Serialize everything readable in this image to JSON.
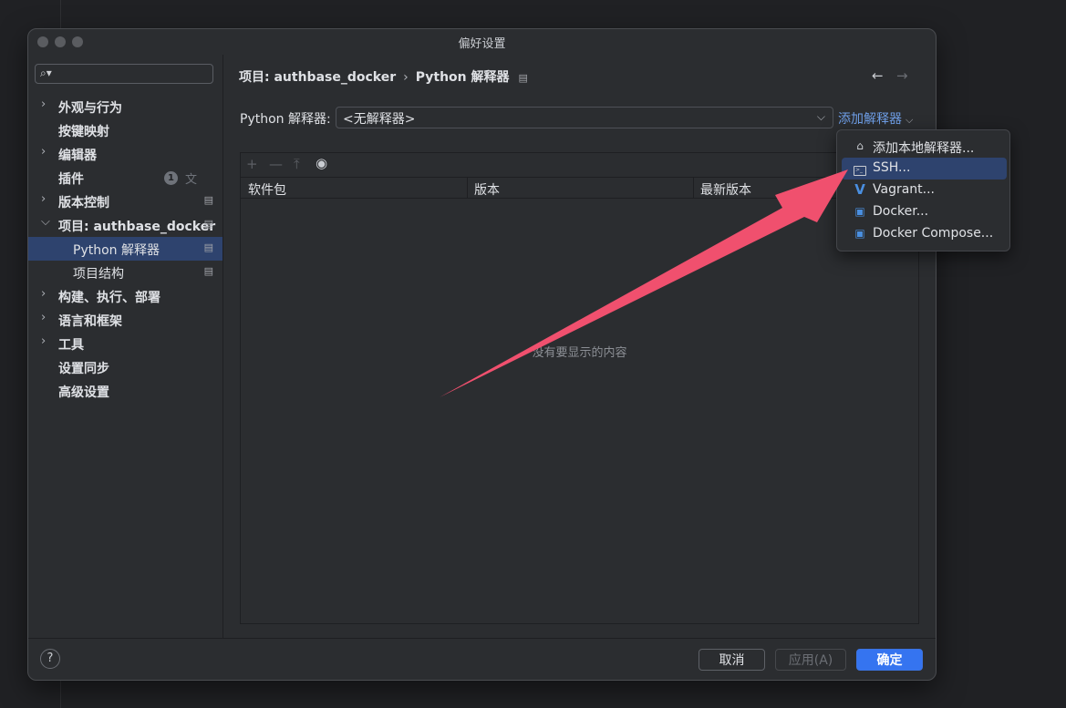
{
  "window": {
    "title": "偏好设置"
  },
  "search": {
    "icon": "search-icon",
    "placeholder": ""
  },
  "sidebar": {
    "items": [
      {
        "label": "外观与行为"
      },
      {
        "label": "按键映射"
      },
      {
        "label": "编辑器"
      },
      {
        "label": "插件",
        "badge": "1"
      },
      {
        "label": "版本控制"
      },
      {
        "label": "项目: authbase_docker"
      },
      {
        "label": "Python 解释器"
      },
      {
        "label": "项目结构"
      },
      {
        "label": "构建、执行、部署"
      },
      {
        "label": "语言和框架"
      },
      {
        "label": "工具"
      },
      {
        "label": "设置同步"
      },
      {
        "label": "高级设置"
      }
    ]
  },
  "breadcrumb": {
    "parent": "项目: authbase_docker",
    "sep": "›",
    "current": "Python 解释器"
  },
  "interpreter": {
    "label": "Python 解释器:",
    "value": "<无解释器>",
    "add_label": "添加解释器"
  },
  "table": {
    "columns": [
      "软件包",
      "版本",
      "最新版本"
    ],
    "empty_text": "没有要显示的内容"
  },
  "dropdown": {
    "items": [
      {
        "label": "添加本地解释器...",
        "icon": "home-icon"
      },
      {
        "label": "SSH...",
        "icon": "terminal-icon"
      },
      {
        "label": "Vagrant...",
        "icon": "vagrant-icon"
      },
      {
        "label": "Docker...",
        "icon": "docker-icon"
      },
      {
        "label": "Docker Compose...",
        "icon": "docker-icon"
      }
    ]
  },
  "footer": {
    "help": "?",
    "cancel": "取消",
    "apply": "应用(A)",
    "ok": "确定"
  },
  "colors": {
    "accent": "#3574f0",
    "link": "#6f9fe8",
    "selection": "#2e436e",
    "annotation_arrow": "#f0506e"
  }
}
